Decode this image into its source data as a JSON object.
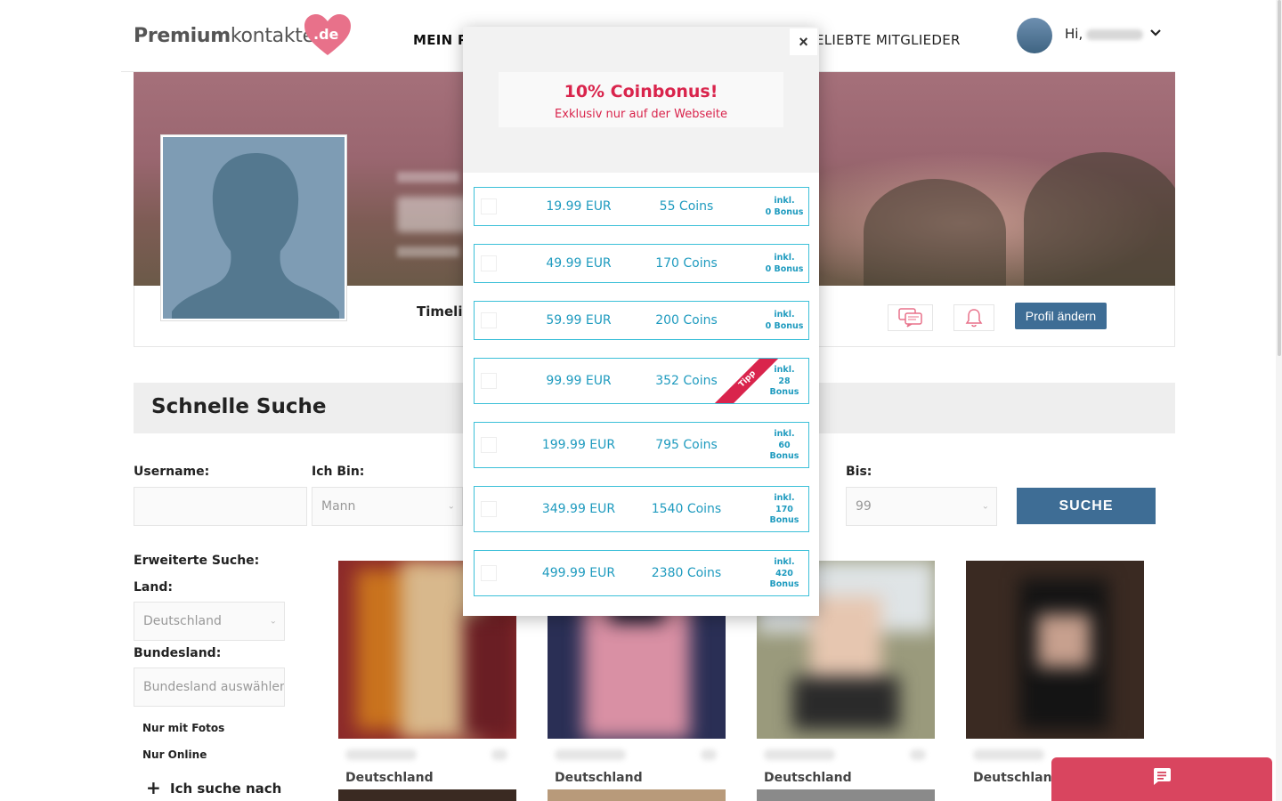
{
  "header": {
    "logo_text_bold": "Premium",
    "logo_text_light": "kontakte",
    "logo_tld": ".de",
    "nav_my": "MEIN P",
    "nav_popular": "ELIEBTE MITGLIEDER",
    "greeting": "Hi,"
  },
  "profile": {
    "timeline_tab": "Timelin",
    "edit_button": "Profil ändern"
  },
  "quick_search": {
    "title": "Schnelle Suche",
    "username_label": "Username:",
    "iam_label": "Ich Bin:",
    "iam_value": "Mann",
    "to_label": "Bis:",
    "to_value": "99",
    "search_button": "SUCHE"
  },
  "advanced_search": {
    "title": "Erweiterte Suche:",
    "country_label": "Land:",
    "country_value": "Deutschland",
    "state_label": "Bundesland:",
    "state_placeholder": "Bundesland auswählen",
    "only_photos": "Nur mit Fotos",
    "only_online": "Nur Online",
    "looking_for": "Ich suche nach"
  },
  "members": [
    {
      "country": "Deutschland"
    },
    {
      "country": "Deutschland"
    },
    {
      "country": "Deutschland"
    },
    {
      "country": "Deutschland"
    }
  ],
  "modal": {
    "close": "×",
    "promo_title": "10% Coinbonus!",
    "promo_subtitle": "Exklusiv nur auf der Webseite",
    "packages": [
      {
        "price": "19.99 EUR",
        "coins": "55 Coins",
        "bonus_l1": "inkl.",
        "bonus_l2": "0 Bonus",
        "bonus_l3": ""
      },
      {
        "price": "49.99 EUR",
        "coins": "170 Coins",
        "bonus_l1": "inkl.",
        "bonus_l2": "0 Bonus",
        "bonus_l3": ""
      },
      {
        "price": "59.99 EUR",
        "coins": "200 Coins",
        "bonus_l1": "inkl.",
        "bonus_l2": "0 Bonus",
        "bonus_l3": ""
      },
      {
        "price": "99.99 EUR",
        "coins": "352 Coins",
        "bonus_l1": "inkl.",
        "bonus_l2": "28",
        "bonus_l3": "Bonus",
        "ribbon": "Tipp"
      },
      {
        "price": "199.99 EUR",
        "coins": "795 Coins",
        "bonus_l1": "inkl.",
        "bonus_l2": "60",
        "bonus_l3": "Bonus"
      },
      {
        "price": "349.99 EUR",
        "coins": "1540 Coins",
        "bonus_l1": "inkl.",
        "bonus_l2": "170",
        "bonus_l3": "Bonus"
      },
      {
        "price": "499.99 EUR",
        "coins": "2380 Coins",
        "bonus_l1": "inkl.",
        "bonus_l2": "420",
        "bonus_l3": "Bonus"
      }
    ]
  },
  "colors": {
    "accent_pink": "#d9244c",
    "package_cyan": "#3cc0d8",
    "button_blue": "#3e6d95"
  }
}
